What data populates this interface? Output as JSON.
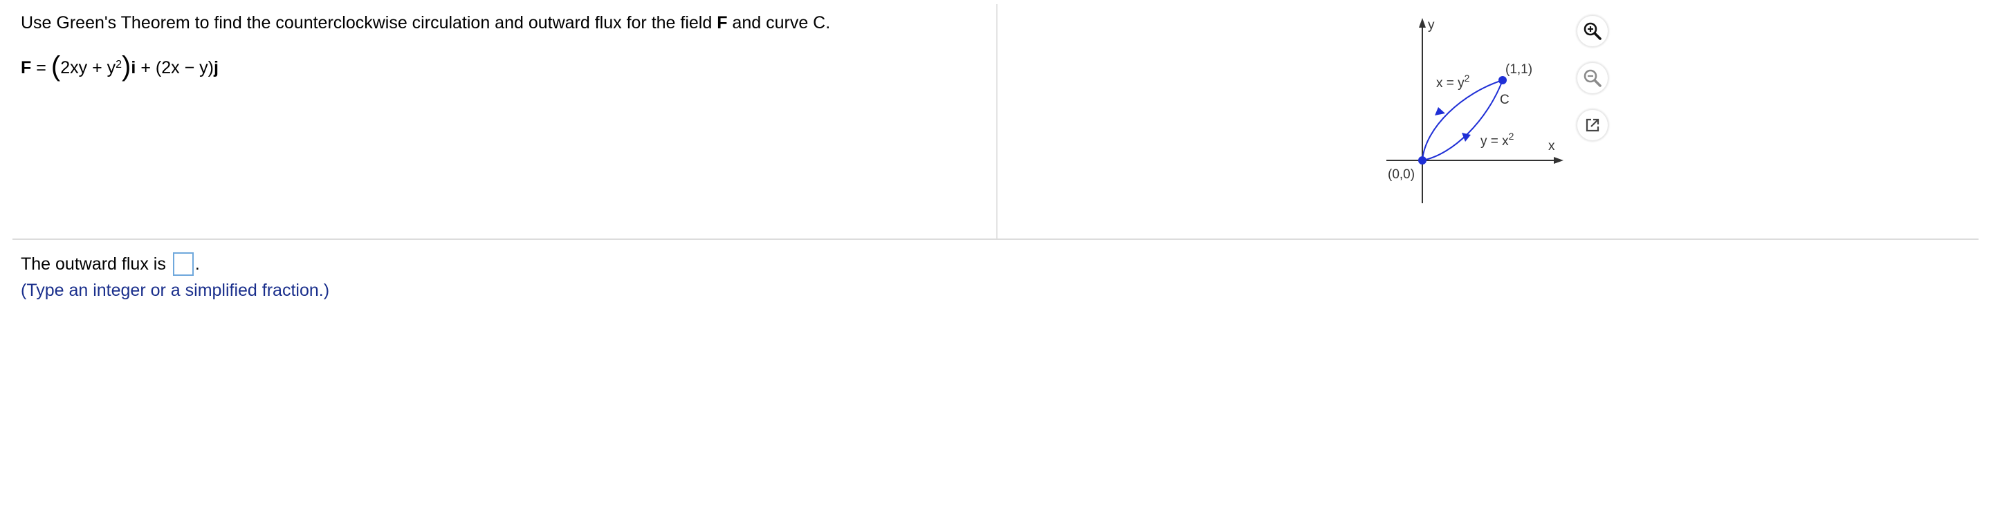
{
  "question": {
    "instruction_before": "Use Green's Theorem to find the counterclockwise circulation and outward flux for the field ",
    "instruction_bold": "F",
    "instruction_after": " and curve C.",
    "field": {
      "lhs": "F",
      "eq": "=",
      "open_paren": "(",
      "term_a": "2xy + y",
      "exp_a": "2",
      "close_paren": ")",
      "unit_i": "i",
      "plus": "+",
      "term_b": "(2x − y)",
      "unit_j": "j"
    }
  },
  "figure": {
    "y_axis_label": "y",
    "x_axis_label": "x",
    "origin_label": "(0,0)",
    "point_label": "(1,1)",
    "curve_label": "C",
    "upper_curve_label_base": "x = y",
    "upper_curve_label_exp": "2",
    "lower_curve_label_base": "y = x",
    "lower_curve_label_exp": "2",
    "curve_color": "#1f2fd6",
    "point_color": "#1f2fd6"
  },
  "toolbar": {
    "zoom_in_icon": "zoom-in-icon",
    "zoom_out_icon": "zoom-out-icon",
    "popout_icon": "popout-icon"
  },
  "answer": {
    "prompt": "The outward flux is",
    "suffix": ".",
    "value": "",
    "hint": "(Type an integer or a simplified fraction.)"
  }
}
